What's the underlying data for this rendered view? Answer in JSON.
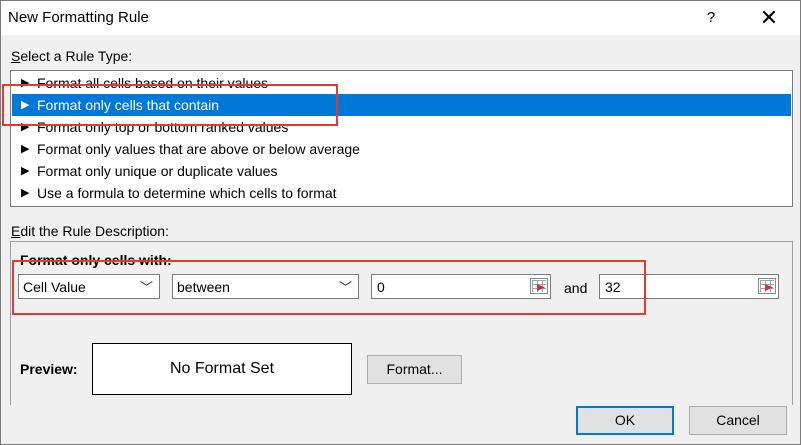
{
  "window": {
    "title": "New Formatting Rule",
    "help": "?",
    "close": "✕"
  },
  "rule_type": {
    "label": "Select a Rule Type:",
    "items": [
      {
        "arrow": "▶",
        "label": "Format all cells based on their values"
      },
      {
        "arrow": "▶",
        "label": "Format only cells that contain"
      },
      {
        "arrow": "▶",
        "label": "Format only top or bottom ranked values"
      },
      {
        "arrow": "▶",
        "label": "Format only values that are above or below average"
      },
      {
        "arrow": "▶",
        "label": "Format only unique or duplicate values"
      },
      {
        "arrow": "▶",
        "label": "Use a formula to determine which cells to format"
      }
    ],
    "selected_index": 1
  },
  "description": {
    "label": "Edit the Rule Description:",
    "format_only_label": "Format only cells with:",
    "condition_select": "Cell Value",
    "operator_select": "between",
    "value1": "0",
    "and_label": "and",
    "value2": "32",
    "chevron": "﹀"
  },
  "preview": {
    "label": "Preview:",
    "text": "No Format Set",
    "format_button": "Format..."
  },
  "footer": {
    "ok": "OK",
    "cancel": "Cancel"
  },
  "colors": {
    "selection": "#0078d7",
    "annotation": "#e53935"
  },
  "icons": {
    "range_picker": "collapse-dialog-icon"
  }
}
